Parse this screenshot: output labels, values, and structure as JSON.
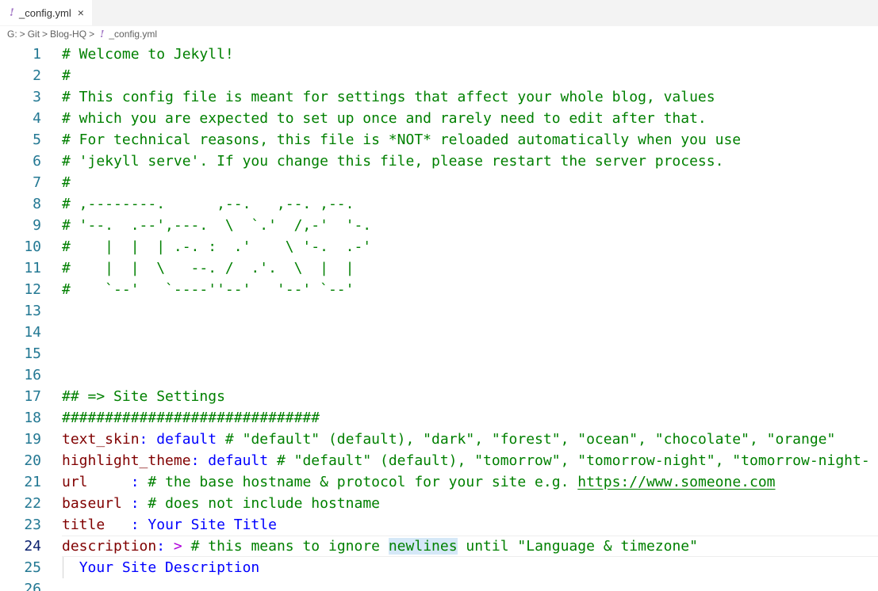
{
  "tab": {
    "icon_glyph": "!",
    "label": "_config.yml",
    "close_glyph": "×"
  },
  "breadcrumb": {
    "items": [
      "G:",
      "Git",
      "Blog-HQ",
      "_config.yml"
    ],
    "separator": ">",
    "file_icon_glyph": "!"
  },
  "editor": {
    "lines": [
      {
        "n": "1",
        "tokens": [
          {
            "t": "comment",
            "v": "# Welcome to Jekyll!"
          }
        ]
      },
      {
        "n": "2",
        "tokens": [
          {
            "t": "comment",
            "v": "#"
          }
        ]
      },
      {
        "n": "3",
        "tokens": [
          {
            "t": "comment",
            "v": "# This config file is meant for settings that affect your whole blog, values"
          }
        ]
      },
      {
        "n": "4",
        "tokens": [
          {
            "t": "comment",
            "v": "# which you are expected to set up once and rarely need to edit after that."
          }
        ]
      },
      {
        "n": "5",
        "tokens": [
          {
            "t": "comment",
            "v": "# For technical reasons, this file is *NOT* reloaded automatically when you use"
          }
        ]
      },
      {
        "n": "6",
        "tokens": [
          {
            "t": "comment",
            "v": "# 'jekyll serve'. If you change this file, please restart the server process."
          }
        ]
      },
      {
        "n": "7",
        "tokens": [
          {
            "t": "comment",
            "v": "#"
          }
        ]
      },
      {
        "n": "8",
        "tokens": [
          {
            "t": "comment",
            "v": "# ,--------.      ,--.   ,--. ,--."
          }
        ]
      },
      {
        "n": "9",
        "tokens": [
          {
            "t": "comment",
            "v": "# '--.  .--',---.  \\  `.'  /,-'  '-."
          }
        ]
      },
      {
        "n": "10",
        "tokens": [
          {
            "t": "comment",
            "v": "#    |  |  | .-. :  .'    \\ '-.  .-'"
          }
        ]
      },
      {
        "n": "11",
        "tokens": [
          {
            "t": "comment",
            "v": "#    |  |  \\   --. /  .'.  \\  |  |"
          }
        ]
      },
      {
        "n": "12",
        "tokens": [
          {
            "t": "comment",
            "v": "#    `--'   `----''--'   '--' `--'"
          }
        ]
      },
      {
        "n": "13",
        "tokens": []
      },
      {
        "n": "14",
        "tokens": []
      },
      {
        "n": "15",
        "tokens": []
      },
      {
        "n": "16",
        "tokens": []
      },
      {
        "n": "17",
        "tokens": [
          {
            "t": "comment",
            "v": "## => Site Settings"
          }
        ]
      },
      {
        "n": "18",
        "tokens": [
          {
            "t": "comment",
            "v": "##############################"
          }
        ]
      },
      {
        "n": "19",
        "tokens": [
          {
            "t": "key",
            "v": "text_skin"
          },
          {
            "t": "punct",
            "v": ": "
          },
          {
            "t": "value",
            "v": "default"
          },
          {
            "t": "comment",
            "v": " # \"default\" (default), \"dark\", \"forest\", \"ocean\", \"chocolate\", \"orange\""
          }
        ]
      },
      {
        "n": "20",
        "tokens": [
          {
            "t": "key",
            "v": "highlight_theme"
          },
          {
            "t": "punct",
            "v": ": "
          },
          {
            "t": "value",
            "v": "default"
          },
          {
            "t": "comment",
            "v": " # \"default\" (default), \"tomorrow\", \"tomorrow-night\", \"tomorrow-night-"
          }
        ]
      },
      {
        "n": "21",
        "tokens": [
          {
            "t": "key",
            "v": "url"
          },
          {
            "t": "plain",
            "v": "     "
          },
          {
            "t": "punct",
            "v": ": "
          },
          {
            "t": "comment",
            "v": "# the base hostname & protocol for your site e.g. "
          },
          {
            "t": "link",
            "v": "https://www.someone.com"
          }
        ]
      },
      {
        "n": "22",
        "tokens": [
          {
            "t": "key",
            "v": "baseurl"
          },
          {
            "t": "plain",
            "v": " "
          },
          {
            "t": "punct",
            "v": ": "
          },
          {
            "t": "comment",
            "v": "# does not include hostname"
          }
        ]
      },
      {
        "n": "23",
        "tokens": [
          {
            "t": "key",
            "v": "title"
          },
          {
            "t": "plain",
            "v": "   "
          },
          {
            "t": "punct",
            "v": ": "
          },
          {
            "t": "value",
            "v": "Your Site Title"
          }
        ]
      },
      {
        "n": "24",
        "current": true,
        "tokens": [
          {
            "t": "key",
            "v": "description"
          },
          {
            "t": "punct",
            "v": ": "
          },
          {
            "t": "indicator",
            "v": ">"
          },
          {
            "t": "comment",
            "v": " # this means to ignore "
          },
          {
            "t": "comment-hl",
            "v": "newlines"
          },
          {
            "t": "comment",
            "v": " until \"Language & timezone\""
          }
        ]
      },
      {
        "n": "25",
        "guide": true,
        "tokens": [
          {
            "t": "plain",
            "v": "  "
          },
          {
            "t": "value",
            "v": "Your Site Description"
          }
        ]
      },
      {
        "n": "26",
        "tokens": []
      }
    ]
  },
  "colors": {
    "comment": "#008000",
    "key": "#800000",
    "value": "#0000ff",
    "line_number": "#237893",
    "line_number_active": "#0b216f",
    "indicator": "#af00db",
    "word_highlight": "#d5e8f7",
    "yml_icon": "#a074c4"
  }
}
